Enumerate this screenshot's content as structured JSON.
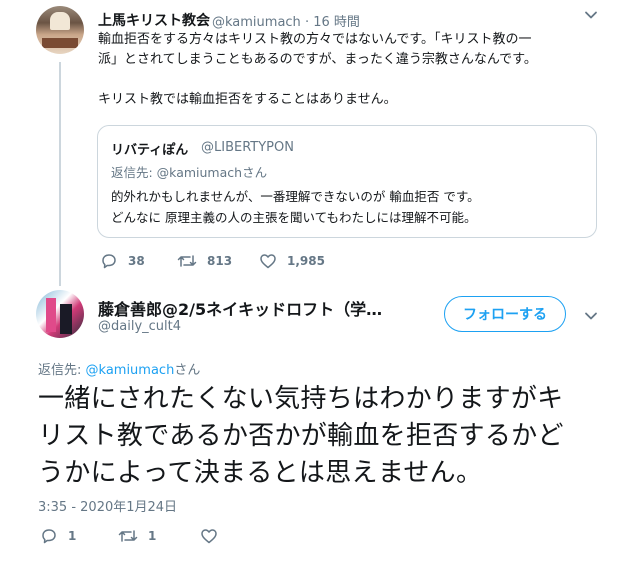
{
  "tweet1": {
    "author_name": "上馬キリスト教会",
    "author_handle": "@kamiumach",
    "time_ago": "16 時間",
    "body_lines": [
      "輸血拒否をする方々はキリスト教の方々ではないんです。「キリスト教の一",
      "派」とされてしまうこともあるのですが、まったく違う宗教さんなんです。",
      "キリスト教では輸血拒否をすることはありません。"
    ],
    "quote": {
      "author_name": "リバティぽん",
      "author_handle": "@LIBERTYPON",
      "reply_to": "返信先: @kamiumachさん",
      "body_lines": [
        "的外れかもしれませんが、一番理解できないのが 輸血拒否 です。",
        "どんなに 原理主義の人の主張を聞いてもわたしには理解不可能。"
      ]
    },
    "actions": {
      "replies": "38",
      "retweets": "813",
      "likes": "1,985"
    }
  },
  "tweet2": {
    "author_name": "藤倉善郎@2/5ネイキッドロフト（学…",
    "author_handle": "@daily_cult4",
    "follow_label": "フォローする",
    "reply_prefix": "返信先: ",
    "reply_link": "@kamiumach",
    "reply_suffix": "さん",
    "body_lines": [
      "一緒にされたくない気持ちはわかりますがキ",
      "リスト教であるか否かが輸血を拒否するかど",
      "うかによって決まるとは思えません。"
    ],
    "timestamp": "3:35 - 2020年1月24日",
    "actions": {
      "replies": "1",
      "retweets": "1",
      "likes": ""
    }
  },
  "icons": {
    "reply": "reply-icon",
    "retweet": "retweet-icon",
    "like": "heart-icon",
    "more": "chevron-down-icon"
  },
  "colors": {
    "accent": "#1da1f2",
    "secondary_text": "#657786",
    "border": "#ccd6dd"
  }
}
